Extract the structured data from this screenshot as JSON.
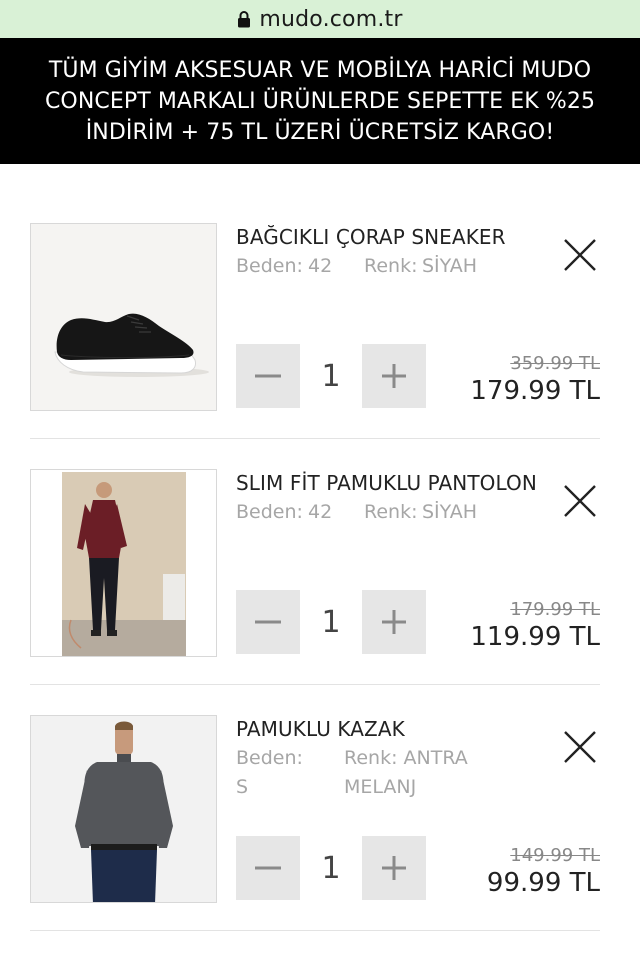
{
  "browser": {
    "url": "mudo.com.tr",
    "lock_icon": "lock-icon"
  },
  "promo": {
    "lines": [
      "TÜM GİYİM AKSESUAR VE MOBİLYA HARİCİ MUDO",
      "CONCEPT MARKALI ÜRÜNLERDE SEPETTE EK %25",
      "İNDİRİM + 75 TL ÜZERİ ÜCRETSİZ KARGO!"
    ]
  },
  "cart": {
    "items": [
      {
        "name": "BAĞCIKLI ÇORAP SNEAKER",
        "size_label": "Beden:",
        "size_value": "42",
        "color_label": "Renk:",
        "color_value": "SİYAH",
        "quantity": "1",
        "old_price": "359.99 TL",
        "new_price": "179.99 TL",
        "image": "black-sneaker"
      },
      {
        "name": "SLIM FİT PAMUKLU PANTOLON",
        "size_label": "Beden:",
        "size_value": "42",
        "color_label": "Renk:",
        "color_value": "SİYAH",
        "quantity": "1",
        "old_price": "179.99 TL",
        "new_price": "119.99 TL",
        "image": "man-in-burgundy-sweater-black-pants"
      },
      {
        "name": "PAMUKLU KAZAK",
        "size_label": "Beden:",
        "size_value": "S",
        "color_label": "Renk: ANTRA",
        "color_value": "MELANJ",
        "quantity": "1",
        "old_price": "149.99 TL",
        "new_price": "99.99 TL",
        "image": "man-in-grey-sweater"
      }
    ]
  },
  "colors": {
    "banner_bg": "#000000",
    "urlbar_bg": "#d9f1d6",
    "qty_button_bg": "#e6e6e6",
    "muted_text": "#a6a6a6"
  }
}
